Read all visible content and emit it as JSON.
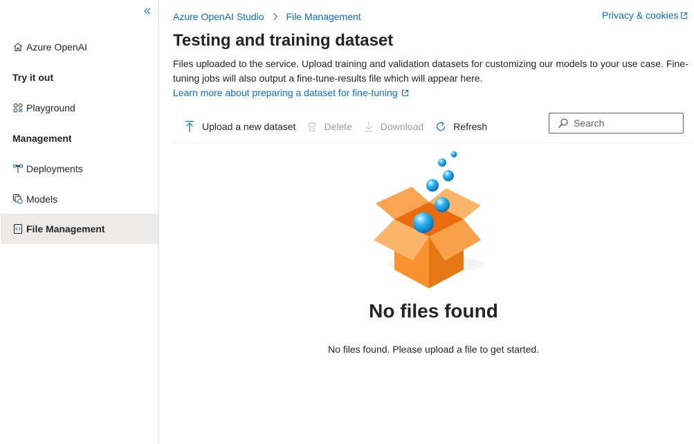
{
  "sidebar": {
    "collapse_icon": "double-chevron-left-icon",
    "items": [
      {
        "label": "Azure OpenAI",
        "icon": "home-icon"
      },
      {
        "label": "Playground",
        "icon": "playground-icon"
      },
      {
        "label": "Deployments",
        "icon": "deployments-icon"
      },
      {
        "label": "Models",
        "icon": "models-icon"
      },
      {
        "label": "File Management",
        "icon": "file-management-icon",
        "active": true
      }
    ],
    "sections": [
      "Try it out",
      "Management"
    ]
  },
  "breadcrumb": [
    "Azure OpenAI Studio",
    "File Management"
  ],
  "header": {
    "privacy_label": "Privacy & cookies",
    "title": "Testing and training dataset",
    "description": "Files uploaded to the service. Upload training and validation datasets for customizing our models to your use case. Fine-tuning jobs will also output a fine-tune-results file which will appear here.",
    "learn_more": "Learn more about preparing a dataset for fine-tuning"
  },
  "toolbar": {
    "upload": "Upload a new dataset",
    "delete": "Delete",
    "download": "Download",
    "refresh": "Refresh"
  },
  "search": {
    "placeholder": "Search"
  },
  "empty_state": {
    "title": "No files found",
    "message": "No files found. Please upload a file to get started."
  },
  "colors": {
    "accent": "#0f6cbd",
    "active_bg": "#edebe9",
    "disabled": "#a19f9d",
    "box_orange": "#f7922f"
  }
}
